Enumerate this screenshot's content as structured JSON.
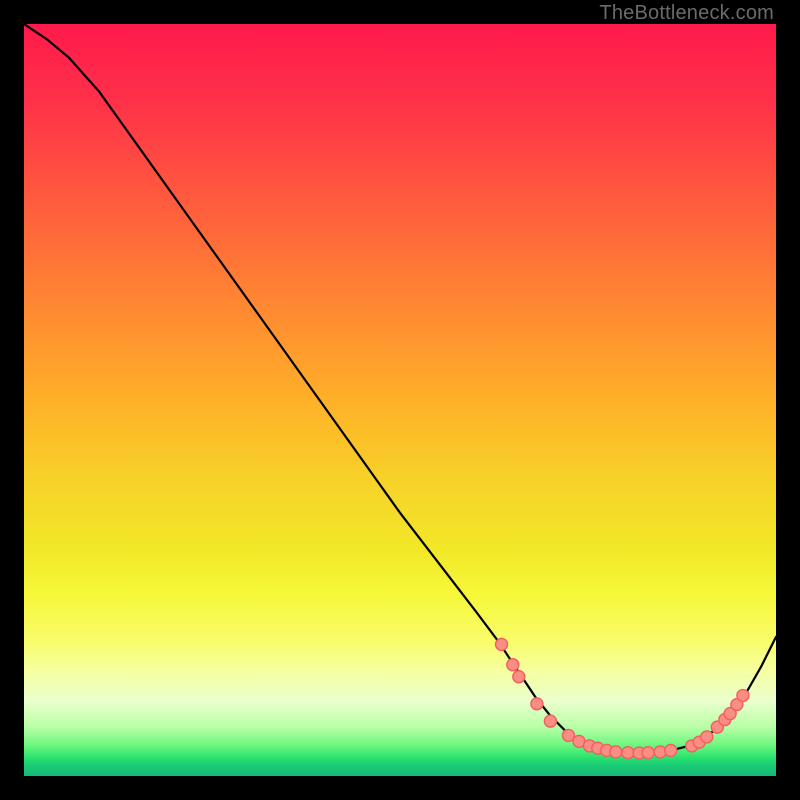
{
  "watermark": {
    "text": "TheBottleneck.com"
  },
  "gradient_stops": [
    {
      "offset": 0.0,
      "color": "#ff1a4b"
    },
    {
      "offset": 0.1,
      "color": "#ff3049"
    },
    {
      "offset": 0.2,
      "color": "#ff5040"
    },
    {
      "offset": 0.3,
      "color": "#ff7038"
    },
    {
      "offset": 0.4,
      "color": "#ff9030"
    },
    {
      "offset": 0.5,
      "color": "#ffb028"
    },
    {
      "offset": 0.6,
      "color": "#f7d028"
    },
    {
      "offset": 0.7,
      "color": "#f2e828"
    },
    {
      "offset": 0.76,
      "color": "#f6f83a"
    },
    {
      "offset": 0.82,
      "color": "#f8fc6a"
    },
    {
      "offset": 0.86,
      "color": "#f6ffa0"
    },
    {
      "offset": 0.9,
      "color": "#eaffcc"
    },
    {
      "offset": 0.935,
      "color": "#b8ffa6"
    },
    {
      "offset": 0.958,
      "color": "#70f780"
    },
    {
      "offset": 0.975,
      "color": "#2be46e"
    },
    {
      "offset": 0.986,
      "color": "#1acb76"
    },
    {
      "offset": 1.0,
      "color": "#14b978"
    }
  ],
  "chart_data": {
    "type": "line",
    "title": "",
    "xlabel": "",
    "ylabel": "",
    "watermark": "TheBottleneck.com",
    "xlim": [
      0,
      100
    ],
    "ylim": [
      0,
      100
    ],
    "grid": false,
    "series": [
      {
        "name": "curve",
        "x": [
          0,
          3,
          6,
          10,
          15,
          20,
          25,
          30,
          35,
          40,
          45,
          50,
          55,
          60,
          63,
          64,
          66,
          68,
          70,
          72,
          74,
          76,
          78,
          80,
          82,
          84,
          86,
          88,
          90,
          92,
          94,
          96,
          98,
          100
        ],
        "y": [
          100,
          98,
          95.5,
          91,
          84,
          77,
          70,
          63,
          56,
          49,
          42,
          35,
          28.5,
          22,
          18,
          16.5,
          13.5,
          10.5,
          8,
          6,
          4.5,
          3.5,
          3.1,
          3.0,
          3.0,
          3.1,
          3.4,
          3.9,
          4.8,
          6.2,
          8.2,
          11,
          14.5,
          18.5
        ]
      }
    ],
    "markers": [
      {
        "x": 63.5,
        "y": 17.5
      },
      {
        "x": 65.0,
        "y": 14.8
      },
      {
        "x": 65.8,
        "y": 13.2
      },
      {
        "x": 68.2,
        "y": 9.6
      },
      {
        "x": 70.0,
        "y": 7.3
      },
      {
        "x": 72.4,
        "y": 5.4
      },
      {
        "x": 73.8,
        "y": 4.6
      },
      {
        "x": 75.2,
        "y": 4.0
      },
      {
        "x": 76.3,
        "y": 3.7
      },
      {
        "x": 77.5,
        "y": 3.4
      },
      {
        "x": 78.7,
        "y": 3.2
      },
      {
        "x": 80.3,
        "y": 3.1
      },
      {
        "x": 81.8,
        "y": 3.05
      },
      {
        "x": 83.0,
        "y": 3.1
      },
      {
        "x": 84.6,
        "y": 3.2
      },
      {
        "x": 86.0,
        "y": 3.4
      },
      {
        "x": 88.8,
        "y": 4.0
      },
      {
        "x": 89.8,
        "y": 4.5
      },
      {
        "x": 90.8,
        "y": 5.2
      },
      {
        "x": 92.2,
        "y": 6.5
      },
      {
        "x": 93.2,
        "y": 7.5
      },
      {
        "x": 93.9,
        "y": 8.3
      },
      {
        "x": 94.8,
        "y": 9.5
      },
      {
        "x": 95.6,
        "y": 10.7
      }
    ],
    "marker_style": {
      "fill": "#fa8d84",
      "stroke": "#f35e5e",
      "r": 6
    },
    "line_style": {
      "stroke": "#000000",
      "width": 2.2
    }
  }
}
